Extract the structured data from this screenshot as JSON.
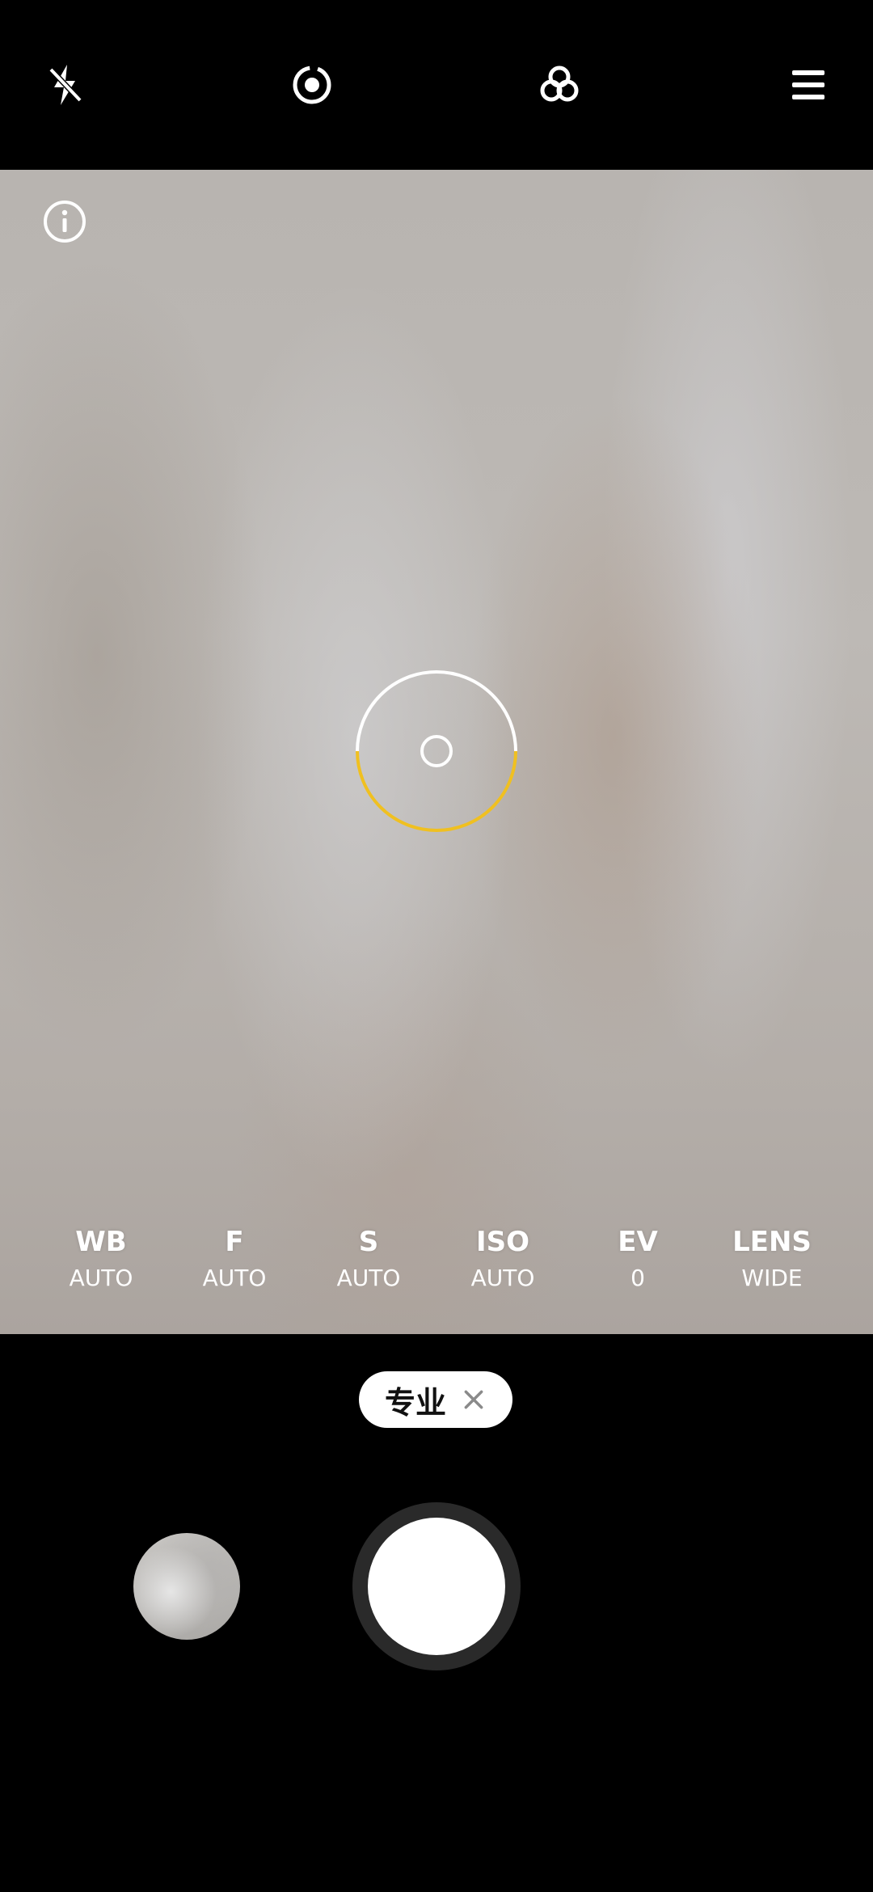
{
  "top_bar": {
    "icons": [
      "flash-off-icon",
      "live-photo-icon",
      "filter-icon",
      "menu-icon"
    ]
  },
  "viewfinder": {
    "info_icon": "info-icon",
    "focus_indicator": "focus-ring"
  },
  "pro_settings": [
    {
      "name": "WB",
      "value": "AUTO"
    },
    {
      "name": "F",
      "value": "AUTO"
    },
    {
      "name": "S",
      "value": "AUTO"
    },
    {
      "name": "ISO",
      "value": "AUTO"
    },
    {
      "name": "EV",
      "value": "0"
    },
    {
      "name": "LENS",
      "value": "WIDE"
    }
  ],
  "mode_chip": {
    "label": "专业",
    "close_icon": "close-icon"
  },
  "colors": {
    "background": "#000000",
    "focus_accent": "#F0C020",
    "white": "#FFFFFF"
  }
}
